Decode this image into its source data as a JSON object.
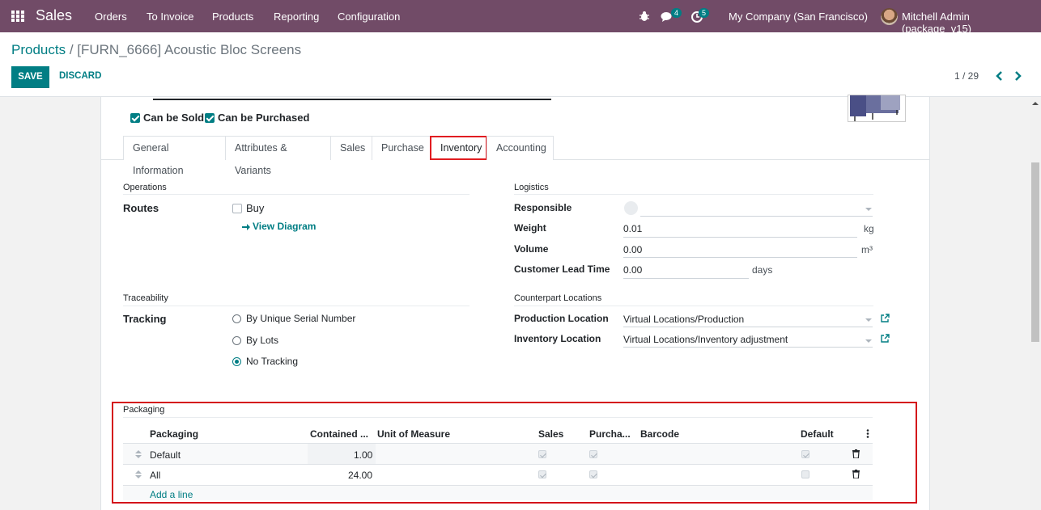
{
  "navbar": {
    "app_name": "Sales",
    "menu": [
      "Orders",
      "To Invoice",
      "Products",
      "Reporting",
      "Configuration"
    ],
    "messages_badge": "4",
    "activity_badge": "5",
    "company": "My Company (San Francisco)",
    "user": "Mitchell Admin (package_v15)"
  },
  "control": {
    "breadcrumb_parent": "Products",
    "breadcrumb_sep": " / ",
    "breadcrumb_current": "[FURN_6666] Acoustic Bloc Screens",
    "save_label": "SAVE",
    "discard_label": "DISCARD",
    "pager": "1 / 29"
  },
  "product": {
    "can_be_sold_label": "Can be Sold",
    "can_be_purchased_label": "Can be Purchased"
  },
  "tabs": [
    "General Information",
    "Attributes & Variants",
    "Sales",
    "Purchase",
    "Inventory",
    "Accounting"
  ],
  "operations": {
    "title": "Operations",
    "routes_label": "Routes",
    "route_buy": "Buy",
    "view_diagram": "View Diagram"
  },
  "traceability": {
    "title": "Traceability",
    "tracking_label": "Tracking",
    "options": [
      "By Unique Serial Number",
      "By Lots",
      "No Tracking"
    ]
  },
  "logistics": {
    "title": "Logistics",
    "responsible_label": "Responsible",
    "weight_label": "Weight",
    "weight_value": "0.01",
    "weight_unit": "kg",
    "volume_label": "Volume",
    "volume_value": "0.00",
    "volume_unit": "m³",
    "lead_time_label": "Customer Lead Time",
    "lead_time_value": "0.00",
    "lead_time_unit": "days"
  },
  "counterpart": {
    "title": "Counterpart Locations",
    "production_label": "Production Location",
    "production_value": "Virtual Locations/Production",
    "inventory_label": "Inventory Location",
    "inventory_value": "Virtual Locations/Inventory adjustment"
  },
  "packaging": {
    "title": "Packaging",
    "columns": [
      "Packaging",
      "Contained ...",
      "Unit of Measure",
      "Sales",
      "Purcha...",
      "Barcode",
      "Default"
    ],
    "rows": [
      {
        "name": "Default",
        "qty": "1.00"
      },
      {
        "name": "All",
        "qty": "24.00"
      }
    ],
    "add_line": "Add a line"
  },
  "colors": {
    "navbar": "#714B67",
    "accent": "#017e84",
    "highlight": "#d4141b"
  }
}
